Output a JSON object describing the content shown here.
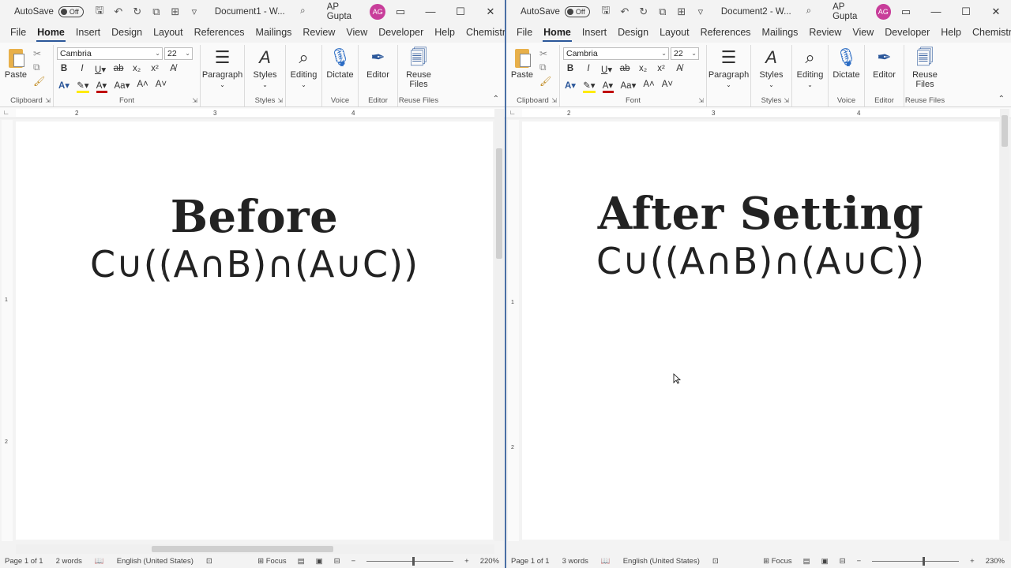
{
  "windows": [
    {
      "autosave_label": "AutoSave",
      "autosave_state": "Off",
      "doc_title": "Document1 - W...",
      "user_name": "AP Gupta",
      "user_initials": "AG",
      "tabs": [
        "File",
        "Home",
        "Insert",
        "Design",
        "Layout",
        "References",
        "Mailings",
        "Review",
        "View",
        "Developer",
        "Help",
        "Chemistry"
      ],
      "active_tab": "Home",
      "font_name": "Cambria",
      "font_size": "22",
      "ribbon": {
        "paste": "Paste",
        "paragraph": "Paragraph",
        "styles": "Styles",
        "editing": "Editing",
        "dictate": "Dictate",
        "editor": "Editor",
        "reuse_files": "Reuse Files",
        "group_clipboard": "Clipboard",
        "group_font": "Font",
        "group_styles": "Styles",
        "group_voice": "Voice",
        "group_editor": "Editor",
        "group_reuse": "Reuse Files"
      },
      "ruler_ticks": [
        "2",
        "3",
        "4"
      ],
      "heading": "Before",
      "expression": "C∪((A∩B)∩(A∪C))",
      "status": {
        "page": "Page 1 of 1",
        "words": "2 words",
        "language": "English (United States)",
        "focus": "Focus",
        "zoom": "220%"
      }
    },
    {
      "autosave_label": "AutoSave",
      "autosave_state": "Off",
      "doc_title": "Document2 - W...",
      "user_name": "AP Gupta",
      "user_initials": "AG",
      "tabs": [
        "File",
        "Home",
        "Insert",
        "Design",
        "Layout",
        "References",
        "Mailings",
        "Review",
        "View",
        "Developer",
        "Help",
        "Chemistry"
      ],
      "active_tab": "Home",
      "font_name": "Cambria",
      "font_size": "22",
      "ribbon": {
        "paste": "Paste",
        "paragraph": "Paragraph",
        "styles": "Styles",
        "editing": "Editing",
        "dictate": "Dictate",
        "editor": "Editor",
        "reuse_files": "Reuse Files",
        "group_clipboard": "Clipboard",
        "group_font": "Font",
        "group_styles": "Styles",
        "group_voice": "Voice",
        "group_editor": "Editor",
        "group_reuse": "Reuse Files"
      },
      "ruler_ticks": [
        "2",
        "3",
        "4"
      ],
      "heading": "After Setting",
      "expression": "C∪((A∩B)∩(A∪C))",
      "status": {
        "page": "Page 1 of 1",
        "words": "3 words",
        "language": "English (United States)",
        "focus": "Focus",
        "zoom": "230%"
      }
    }
  ],
  "vertical_ruler_ticks": [
    "1",
    "2"
  ],
  "colors": {
    "accent": "#2b579a",
    "avatar": "#c83d9a",
    "highlight": "#ffeb00",
    "font_color": "#c00000",
    "divider": "#4a6fa5"
  },
  "icons": {
    "save": "save-icon",
    "undo": "undo-icon",
    "redo": "redo-icon",
    "search": "search-icon",
    "minimize": "minimize-icon",
    "maximize": "maximize-icon",
    "close": "close-icon"
  }
}
